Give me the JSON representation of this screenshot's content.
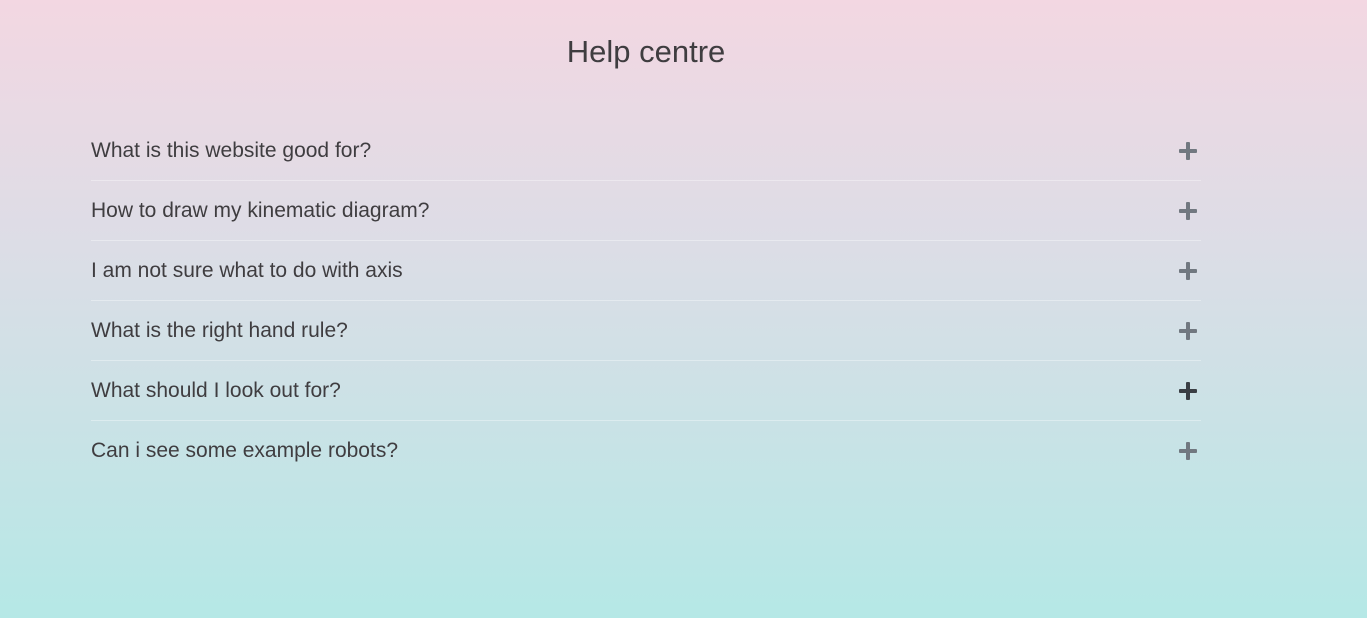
{
  "page": {
    "title": "Help centre"
  },
  "faq": {
    "items": [
      {
        "question": "What is this website good for?",
        "icon": "plus-icon"
      },
      {
        "question": "How to draw my kinematic diagram?",
        "icon": "plus-icon"
      },
      {
        "question": "I am not sure what to do with axis",
        "icon": "plus-icon"
      },
      {
        "question": "What is the right hand rule?",
        "icon": "plus-icon"
      },
      {
        "question": "What should I look out for?",
        "icon": "plus-icon",
        "hovered": true
      },
      {
        "question": "Can i see some example robots?",
        "icon": "plus-icon"
      }
    ]
  },
  "colors": {
    "gradient_top": "#f3d7e2",
    "gradient_bottom": "#b5e8e6",
    "text": "#3f3d40",
    "icon": "#717880",
    "icon_hover": "#3a3e44"
  }
}
